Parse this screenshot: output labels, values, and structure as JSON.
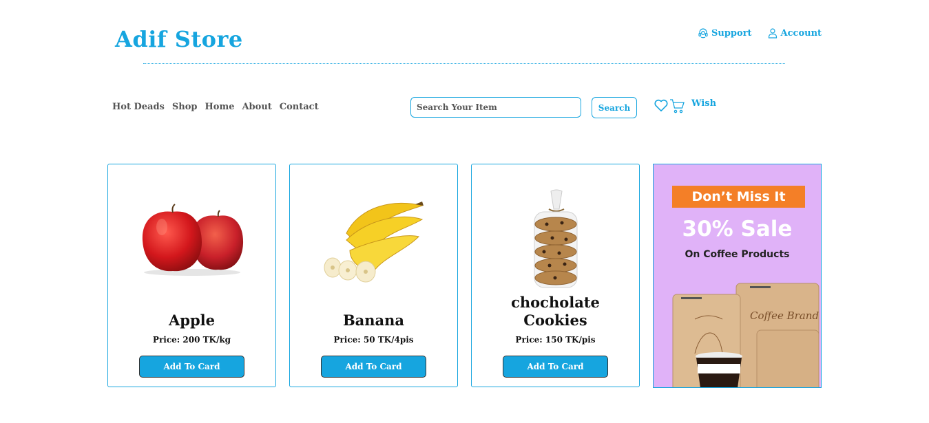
{
  "header": {
    "brand": "Adif Store",
    "support_label": "Support",
    "account_label": "Account"
  },
  "nav": {
    "items": [
      "Hot Deads",
      "Shop",
      "Home",
      "About",
      "Contact"
    ]
  },
  "search": {
    "placeholder": "Search Your Item",
    "value": "",
    "button_label": "Search"
  },
  "wish": {
    "label": "Wish"
  },
  "products": [
    {
      "name": "Apple",
      "price": "Price: 200 TK/kg",
      "button": "Add To Card"
    },
    {
      "name": "Banana",
      "price": "Price: 50 TK/4pis",
      "button": "Add To Card"
    },
    {
      "name": "chocholate Cookies",
      "price": "Price: 150 TK/pis",
      "button": "Add To Card"
    }
  ],
  "promo": {
    "tag": "Don’t Miss It",
    "headline": "30% Sale",
    "subtitle": "On Coffee Products",
    "bag_label": "Coffee Brand"
  },
  "colors": {
    "accent": "#16a5df",
    "promo_bg": "#e0b2f8",
    "promo_tag": "#f47f27"
  },
  "icons": [
    "support-icon",
    "account-icon",
    "heart-icon",
    "cart-icon"
  ]
}
